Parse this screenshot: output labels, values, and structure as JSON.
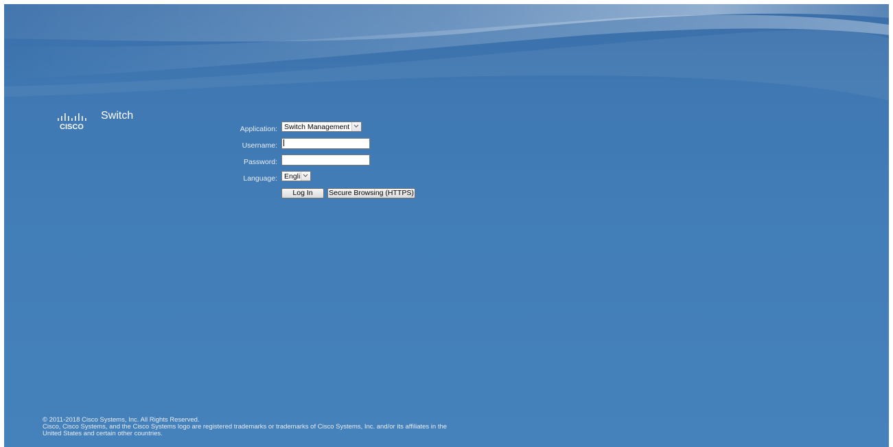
{
  "header": {
    "product_name": "Switch",
    "logo": "cisco-logo",
    "logo_text": "CISCO"
  },
  "login_form": {
    "application": {
      "label": "Application:",
      "selected": "Switch Management"
    },
    "username": {
      "label": "Username:",
      "value": ""
    },
    "password": {
      "label": "Password:",
      "value": ""
    },
    "language": {
      "label": "Language:",
      "selected": "English"
    },
    "login_button": "Log In",
    "secure_button": "Secure Browsing (HTTPS)"
  },
  "footer": {
    "copyright": "© 2011-2018 Cisco Systems, Inc. All Rights Reserved.",
    "trademark_line1": "Cisco, Cisco Systems, and the Cisco Systems logo are registered trademarks or trademarks of Cisco Systems, Inc. and/or its affiliates in the",
    "trademark_line2": "United States and certain other countries."
  },
  "colors": {
    "background": "#427db7",
    "text": "#ffffff"
  }
}
